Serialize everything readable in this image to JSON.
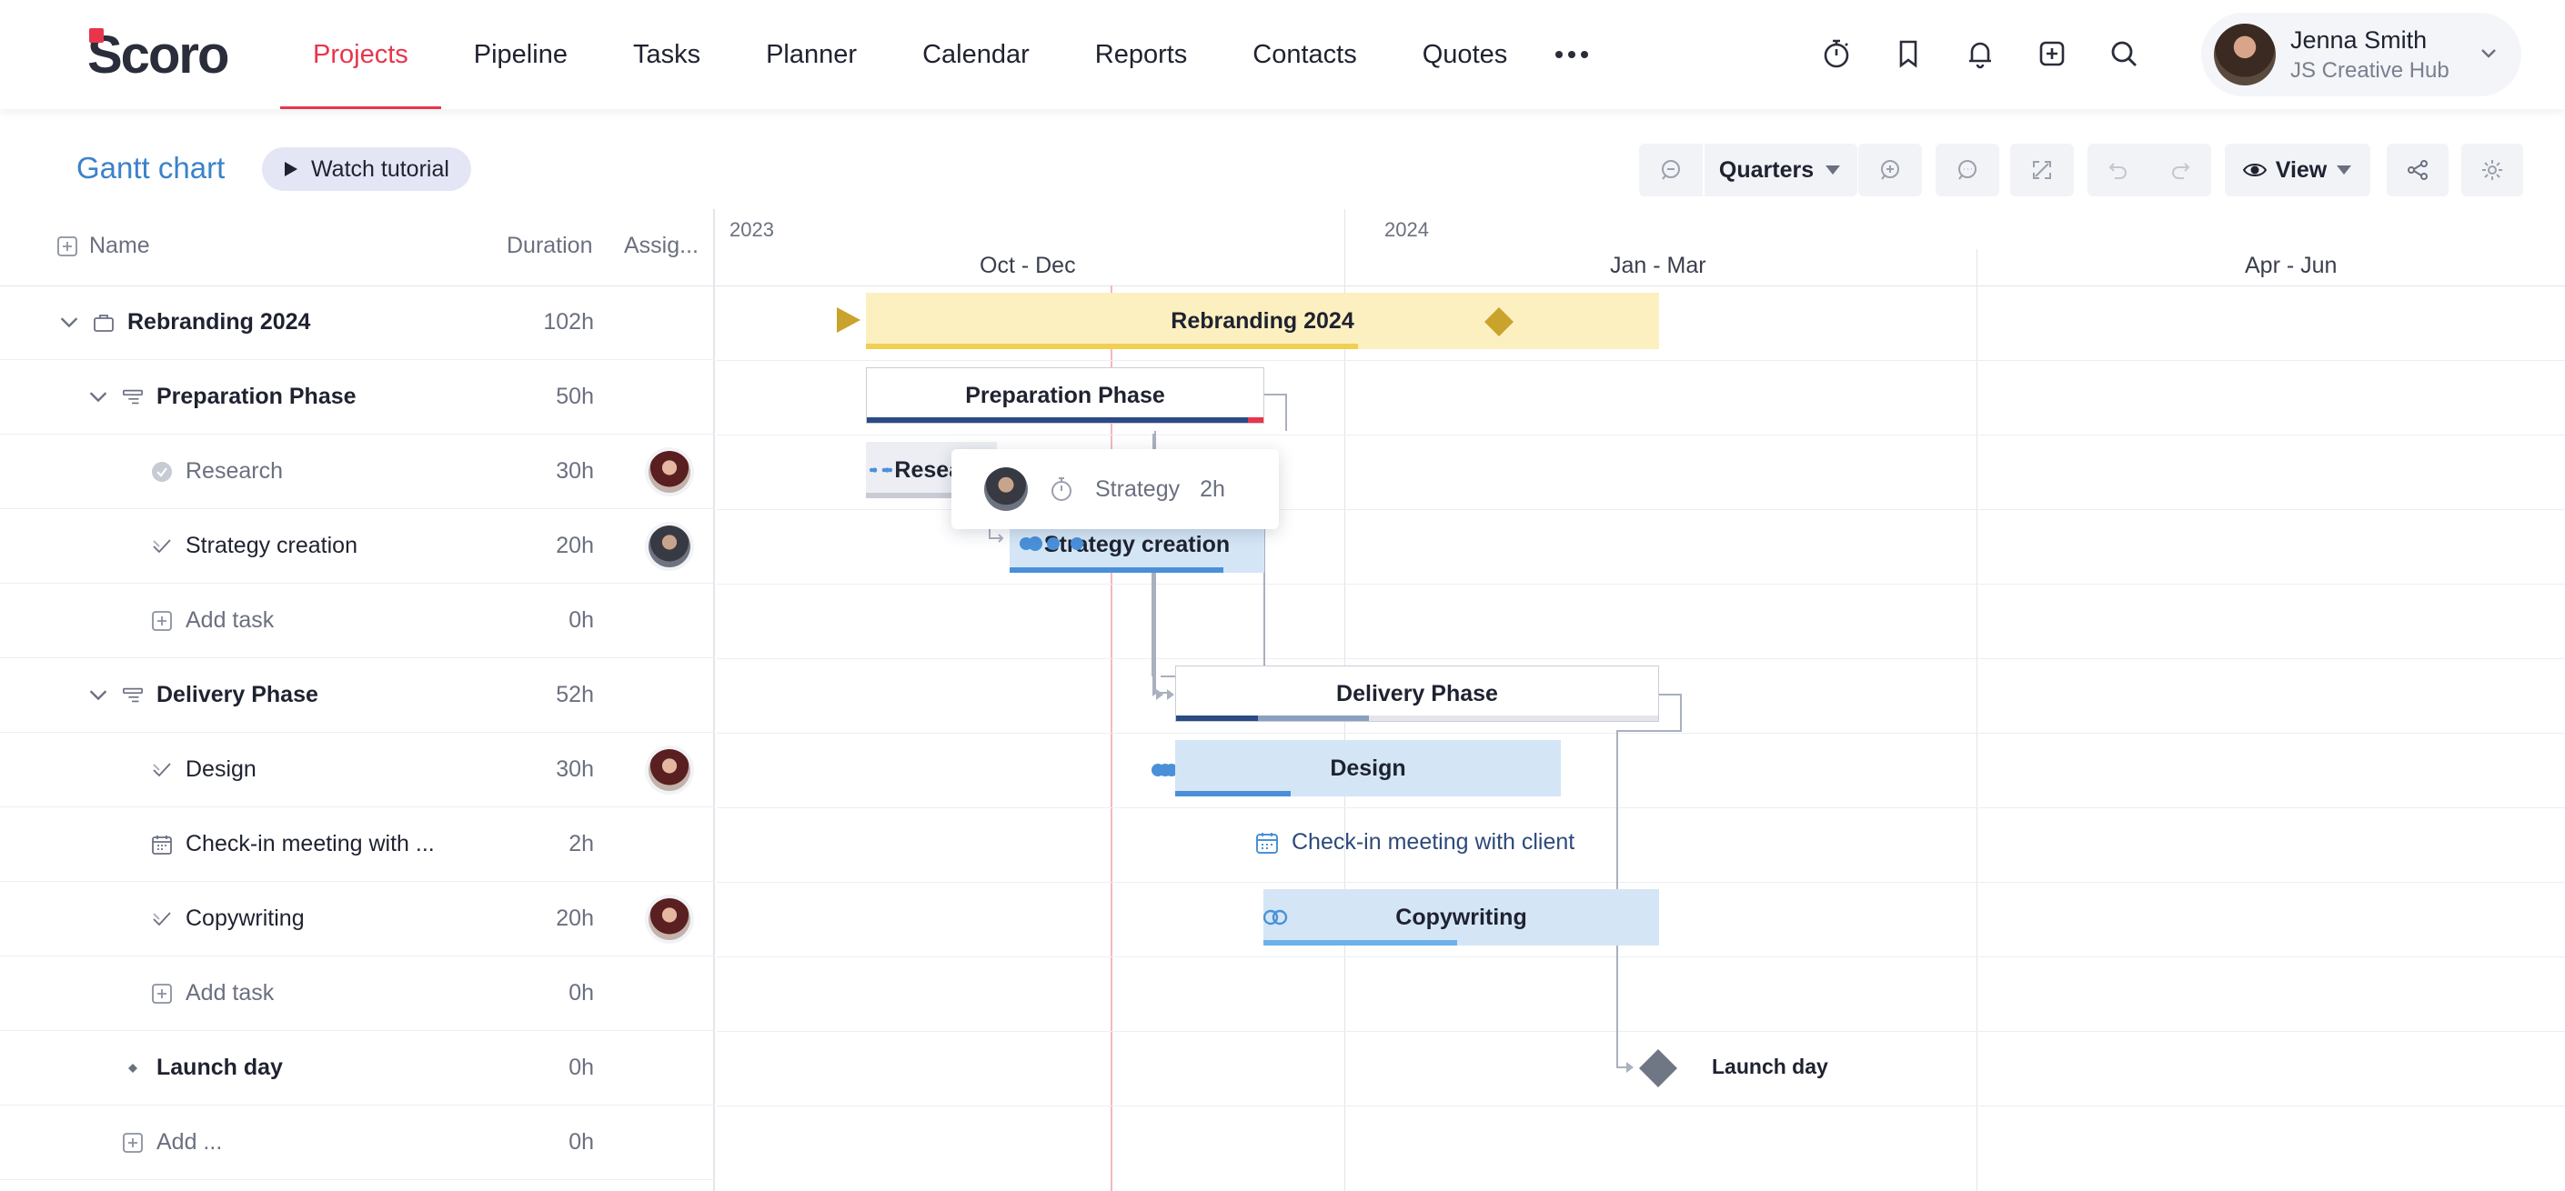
{
  "brand": {
    "logo_text": "Scoro",
    "accent": "#e8354b",
    "link_color": "#3b82c9"
  },
  "nav": {
    "items": [
      {
        "label": "Projects",
        "active": true
      },
      {
        "label": "Pipeline"
      },
      {
        "label": "Tasks"
      },
      {
        "label": "Planner"
      },
      {
        "label": "Calendar"
      },
      {
        "label": "Reports"
      },
      {
        "label": "Contacts"
      },
      {
        "label": "Quotes"
      }
    ],
    "more_icon": "ellipsis-icon",
    "icons": [
      "stopwatch-icon",
      "bookmark-icon",
      "bell-icon",
      "add-square-icon",
      "search-icon"
    ]
  },
  "user": {
    "name": "Jenna Smith",
    "org": "JS Creative Hub"
  },
  "toolbar": {
    "title": "Gantt chart",
    "tutorial_label": "Watch tutorial",
    "scale_label": "Quarters",
    "view_label": "View"
  },
  "columns": {
    "name": "Name",
    "duration": "Duration",
    "assignee": "Assig..."
  },
  "rows": [
    {
      "name": "Rebranding 2024",
      "duration": "102h"
    },
    {
      "name": "Preparation Phase",
      "duration": "50h"
    },
    {
      "name": "Research",
      "duration": "30h"
    },
    {
      "name": "Strategy creation",
      "duration": "20h"
    },
    {
      "name": "Add task",
      "duration": "0h"
    },
    {
      "name": "Delivery Phase",
      "duration": "52h"
    },
    {
      "name": "Design",
      "duration": "30h"
    },
    {
      "name": "Check-in meeting with ...",
      "duration": "2h"
    },
    {
      "name": "Copywriting",
      "duration": "20h"
    },
    {
      "name": "Add task",
      "duration": "0h"
    },
    {
      "name": "Launch day",
      "duration": "0h"
    },
    {
      "name": "Add ...",
      "duration": "0h"
    }
  ],
  "timeline": {
    "years": [
      "2023",
      "2024"
    ],
    "quarters": [
      "Oct - Dec",
      "Jan - Mar",
      "Apr - Jun"
    ],
    "bars": {
      "project": "Rebranding 2024",
      "prep_phase": "Preparation Phase",
      "research": "Research",
      "strategy": "Strategy creation",
      "delivery_phase": "Delivery Phase",
      "design": "Design",
      "meeting": "Check-in meeting with client",
      "copywriting": "Copywriting",
      "launch": "Launch day"
    },
    "tooltip": {
      "task": "Strategy",
      "hours": "2h"
    }
  }
}
